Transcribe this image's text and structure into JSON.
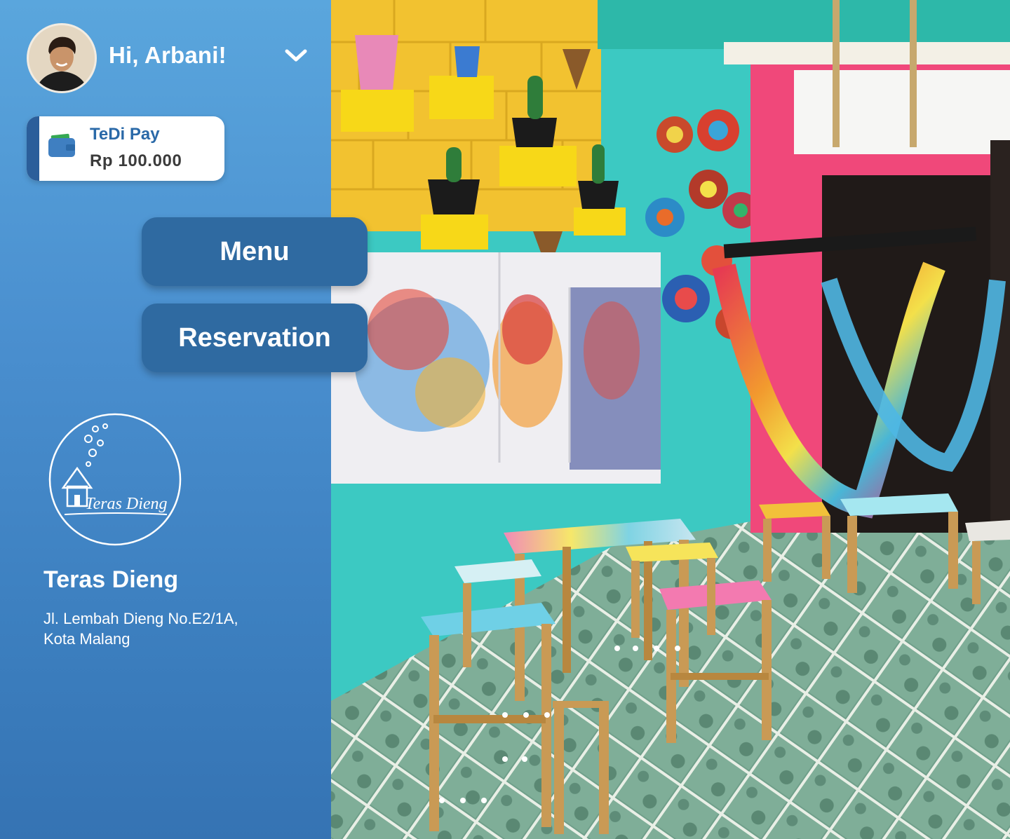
{
  "user": {
    "greeting": "Hi, Arbani!"
  },
  "wallet": {
    "name": "TeDi Pay",
    "balance": "Rp 100.000"
  },
  "nav": {
    "menu_label": "Menu",
    "reservation_label": "Reservation"
  },
  "venue": {
    "logo_text": "Teras Dieng",
    "name": "Teras Dieng",
    "address_line1": "Jl. Lembah Dieng No.E2/1A,",
    "address_line2": "Kota Malang"
  },
  "icons": {
    "account_toggle": "chevron-down-icon",
    "wallet": "wallet-icon"
  },
  "colors": {
    "sidebar_top": "#5aa6dd",
    "sidebar_bottom": "#3573b3",
    "button_bg": "#2f6aa1",
    "wallet_accent": "#2b5e9a",
    "wallet_title": "#2a69a8"
  }
}
